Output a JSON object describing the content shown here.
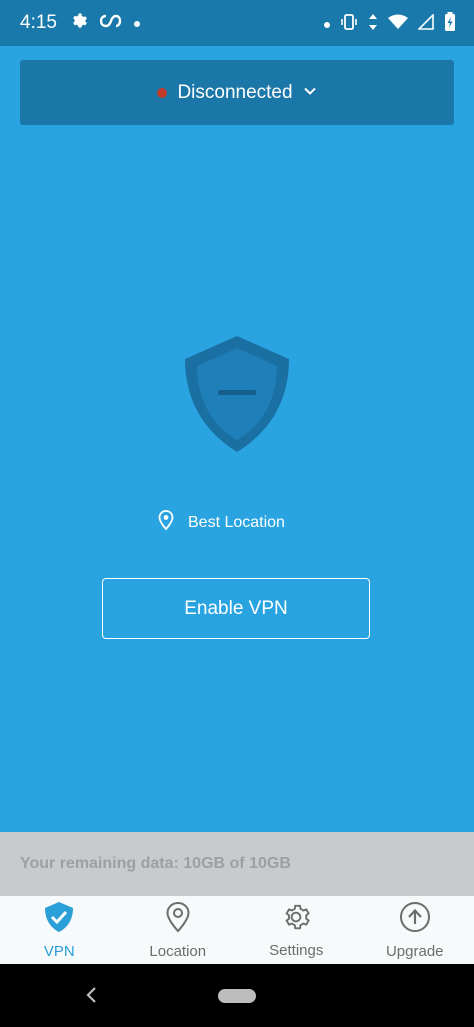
{
  "status_bar": {
    "time": "4:15",
    "icons_left": [
      "gear-icon",
      "infinity-icon",
      "dot-icon"
    ],
    "icons_right": [
      "dot-icon",
      "vibrate-icon",
      "data-arrows-icon",
      "wifi-icon",
      "signal-icon",
      "battery-icon"
    ]
  },
  "connection": {
    "status_label": "Disconnected",
    "status_color": "#c0392b"
  },
  "location": {
    "label": "Best Location"
  },
  "actions": {
    "enable_label": "Enable VPN"
  },
  "data_usage": {
    "text": "Your remaining data: 10GB of 10GB"
  },
  "bottom_nav": {
    "items": [
      {
        "label": "VPN",
        "icon": "shield-check-icon",
        "active": true
      },
      {
        "label": "Location",
        "icon": "location-pin-icon",
        "active": false
      },
      {
        "label": "Settings",
        "icon": "gear-icon",
        "active": false
      },
      {
        "label": "Upgrade",
        "icon": "upgrade-arrow-icon",
        "active": false
      }
    ]
  },
  "colors": {
    "background": "#2aa4e0",
    "header": "#1979ab",
    "accent": "#2a9fd8"
  }
}
